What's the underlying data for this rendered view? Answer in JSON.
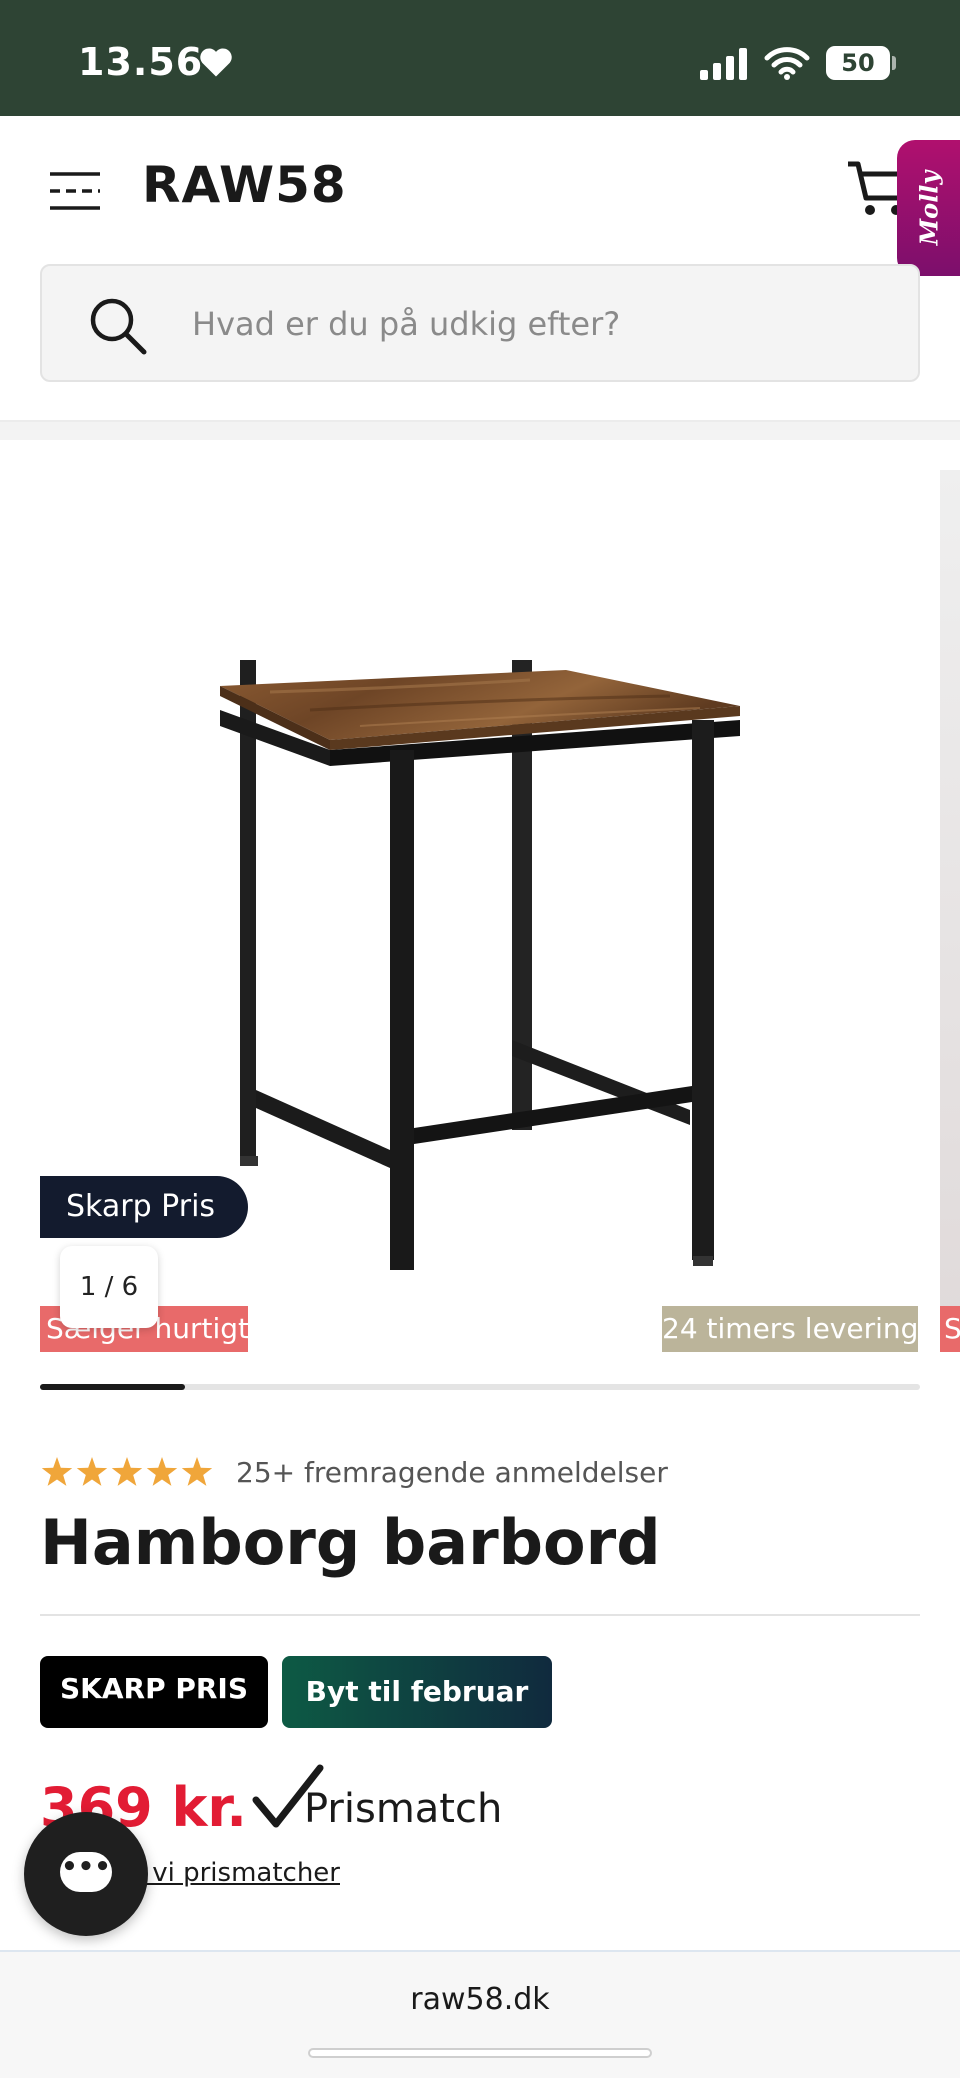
{
  "status_bar": {
    "time": "13.56",
    "battery": "50"
  },
  "header": {
    "logo": "RAW58",
    "assistant_tab": "Molly"
  },
  "search": {
    "placeholder": "Hvad er du på udkig efter?"
  },
  "gallery": {
    "promo_pill": "Skarp Pris",
    "counter": "1 / 6",
    "badge_left": "Sælger hurtigt",
    "badge_right": "24 timers levering",
    "progress_fraction": 0.165
  },
  "product": {
    "rating_stars": 5,
    "reviews": "25+ fremragende anmeldelser",
    "title": "Hamborg barbord",
    "tags": [
      "SKARP PRIS",
      "Byt til februar"
    ],
    "price": "369 kr.",
    "prismatch": "Prismatch",
    "prismatch_link": "Hvorfor vi prismatcher"
  },
  "browser": {
    "url": "raw58.dk"
  },
  "colors": {
    "status_bar": "#2e4434",
    "price": "#e21c34",
    "star": "#f0a63a",
    "badge_sells": "#e86a6a",
    "badge_delivery": "#bbb49a"
  }
}
